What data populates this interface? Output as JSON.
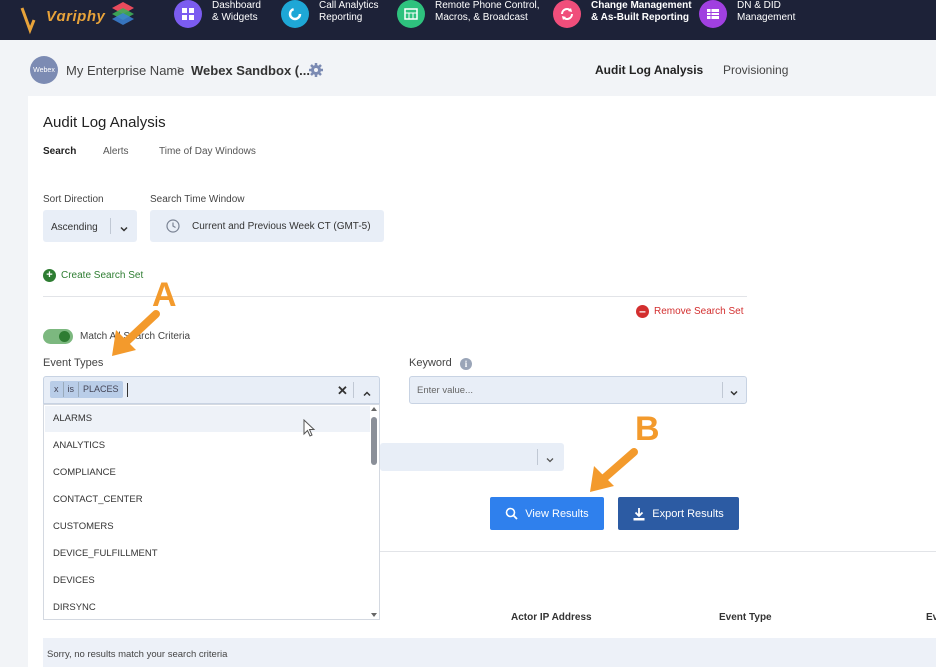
{
  "brand": {
    "logo_text": "Vɑriphy"
  },
  "nav": [
    {
      "label": "Dashboard\n& Widgets",
      "line1": "Dashboard",
      "line2": "& Widgets",
      "color": "#7b5cf0",
      "icon": "grid-icon",
      "bold": false
    },
    {
      "label": "Call Analytics Reporting",
      "line1": "Call Analytics",
      "line2": "Reporting",
      "color": "#1ea7d6",
      "icon": "refresh-circle-icon",
      "bold": false
    },
    {
      "label": "Remote Phone Control, Macros, & Broadcast",
      "line1": "Remote Phone Control,",
      "line2": "Macros, & Broadcast",
      "color": "#2ec27e",
      "icon": "phone-grid-icon",
      "bold": false
    },
    {
      "label": "Change Management & As-Built Reporting",
      "line1": "Change Management",
      "line2": "& As-Built Reporting",
      "color": "#f04e7b",
      "icon": "sync-icon",
      "bold": true
    },
    {
      "label": "DN & DID Management",
      "line1": "DN & DID",
      "line2": "Management",
      "color": "#a040e0",
      "icon": "list-icon",
      "bold": false
    }
  ],
  "breadcrumb": {
    "avatar": "Webex",
    "enterprise": "My Enterprise Name",
    "separator": ">",
    "site": "Webex Sandbox (..."
  },
  "top_tabs": [
    {
      "label": "Audit Log Analysis",
      "active": true
    },
    {
      "label": "Provisioning",
      "active": false
    }
  ],
  "page": {
    "title": "Audit Log Analysis",
    "tabs": [
      {
        "label": "Search",
        "active": true
      },
      {
        "label": "Alerts",
        "active": false
      },
      {
        "label": "Time of Day Windows",
        "active": false
      }
    ],
    "sort_direction": {
      "label": "Sort Direction",
      "value": "Ascending"
    },
    "time_window": {
      "label": "Search Time Window",
      "value": "Current and Previous Week CT (GMT-5)"
    },
    "create_search_set": "Create Search Set",
    "remove_search_set": "Remove Search Set",
    "match_criteria": "Match All Search Criteria",
    "event_types": {
      "label": "Event Types",
      "chip": {
        "remove": "x",
        "op": "is",
        "value": "PLACES"
      },
      "options": [
        "ALARMS",
        "ANALYTICS",
        "COMPLIANCE",
        "CONTACT_CENTER",
        "CUSTOMERS",
        "DEVICE_FULFILLMENT",
        "DEVICES",
        "DIRSYNC"
      ]
    },
    "keyword": {
      "label": "Keyword",
      "placeholder": "Enter value..."
    },
    "view_results": "View Results",
    "export_results": "Export Results",
    "table_headers": [
      "Actor IP Address",
      "Event Type",
      "Ev"
    ],
    "empty_message": "Sorry, no results match your search criteria"
  },
  "annotations": {
    "a": "A",
    "b": "B",
    "color": "#f39a2c"
  }
}
